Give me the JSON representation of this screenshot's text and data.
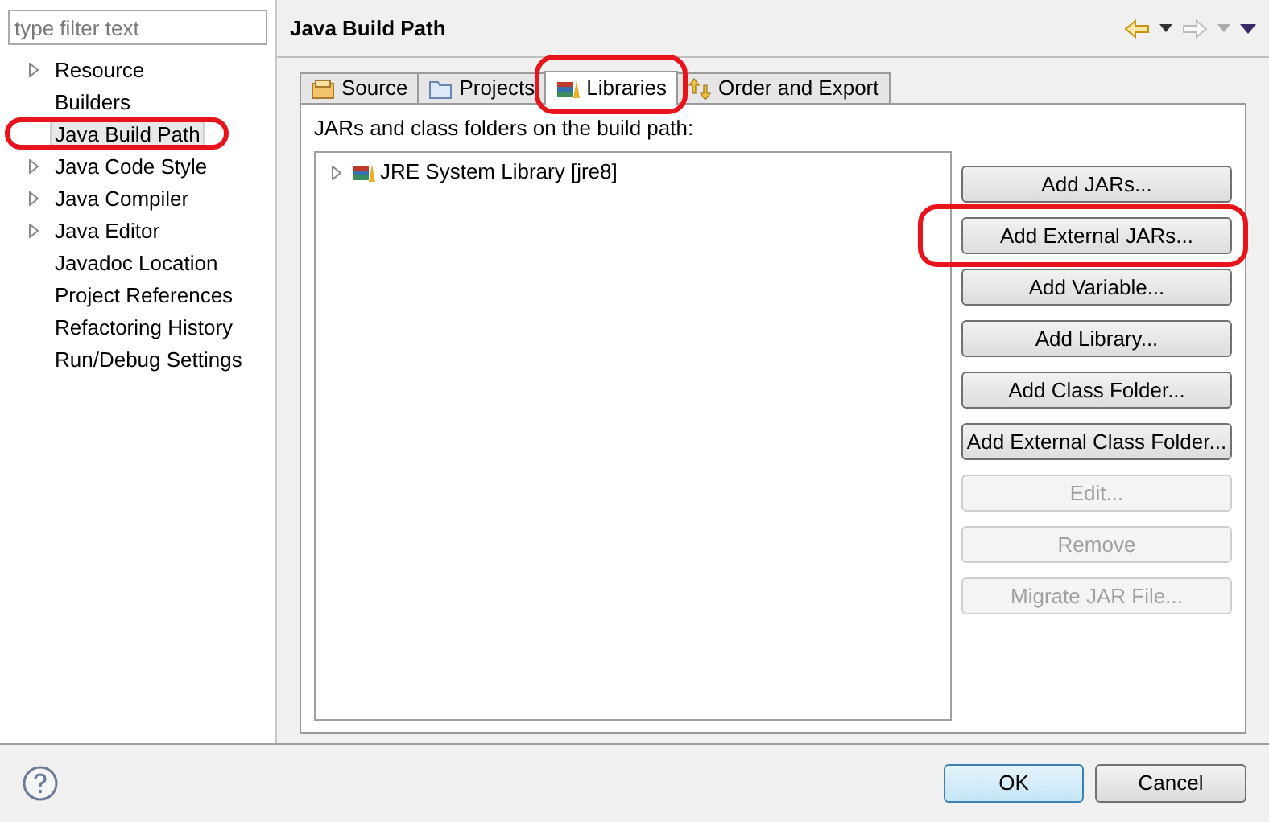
{
  "sidebar": {
    "filter": {
      "placeholder": "type filter text"
    },
    "items": [
      {
        "label": "Resource",
        "expandable": true,
        "selected": false,
        "highlighted": false
      },
      {
        "label": "Builders",
        "expandable": false,
        "selected": false,
        "highlighted": false
      },
      {
        "label": "Java Build Path",
        "expandable": false,
        "selected": true,
        "highlighted": true
      },
      {
        "label": "Java Code Style",
        "expandable": true,
        "selected": false,
        "highlighted": false
      },
      {
        "label": "Java Compiler",
        "expandable": true,
        "selected": false,
        "highlighted": false
      },
      {
        "label": "Java Editor",
        "expandable": true,
        "selected": false,
        "highlighted": false
      },
      {
        "label": "Javadoc Location",
        "expandable": false,
        "selected": false,
        "highlighted": false
      },
      {
        "label": "Project References",
        "expandable": false,
        "selected": false,
        "highlighted": false
      },
      {
        "label": "Refactoring History",
        "expandable": false,
        "selected": false,
        "highlighted": false
      },
      {
        "label": "Run/Debug Settings",
        "expandable": false,
        "selected": false,
        "highlighted": false
      }
    ]
  },
  "page": {
    "title": "Java Build Path",
    "tabs": [
      {
        "label": "Source",
        "kind": "source",
        "selected": false,
        "highlighted": false
      },
      {
        "label": "Projects",
        "kind": "folder",
        "selected": false,
        "highlighted": false
      },
      {
        "label": "Libraries",
        "kind": "library",
        "selected": true,
        "highlighted": true
      },
      {
        "label": "Order and Export",
        "kind": "order",
        "selected": false,
        "highlighted": false
      }
    ],
    "list_label": "JARs and class folders on the build path:",
    "tree": [
      {
        "label": "JRE System Library [jre8]",
        "expandable": true
      }
    ],
    "button_groups": [
      [
        {
          "label": "Add JARs...",
          "disabled": false,
          "highlighted": false
        },
        {
          "label": "Add External JARs...",
          "disabled": false,
          "highlighted": true
        },
        {
          "label": "Add Variable...",
          "disabled": false,
          "highlighted": false
        },
        {
          "label": "Add Library...",
          "disabled": false,
          "highlighted": false
        },
        {
          "label": "Add Class Folder...",
          "disabled": false,
          "highlighted": false
        },
        {
          "label": "Add External Class Folder...",
          "disabled": false,
          "highlighted": false
        }
      ],
      [
        {
          "label": "Edit...",
          "disabled": true,
          "highlighted": false
        },
        {
          "label": "Remove",
          "disabled": true,
          "highlighted": false
        }
      ],
      [
        {
          "label": "Migrate JAR File...",
          "disabled": true,
          "highlighted": false
        }
      ]
    ]
  },
  "footer": {
    "ok": "OK",
    "cancel": "Cancel"
  }
}
